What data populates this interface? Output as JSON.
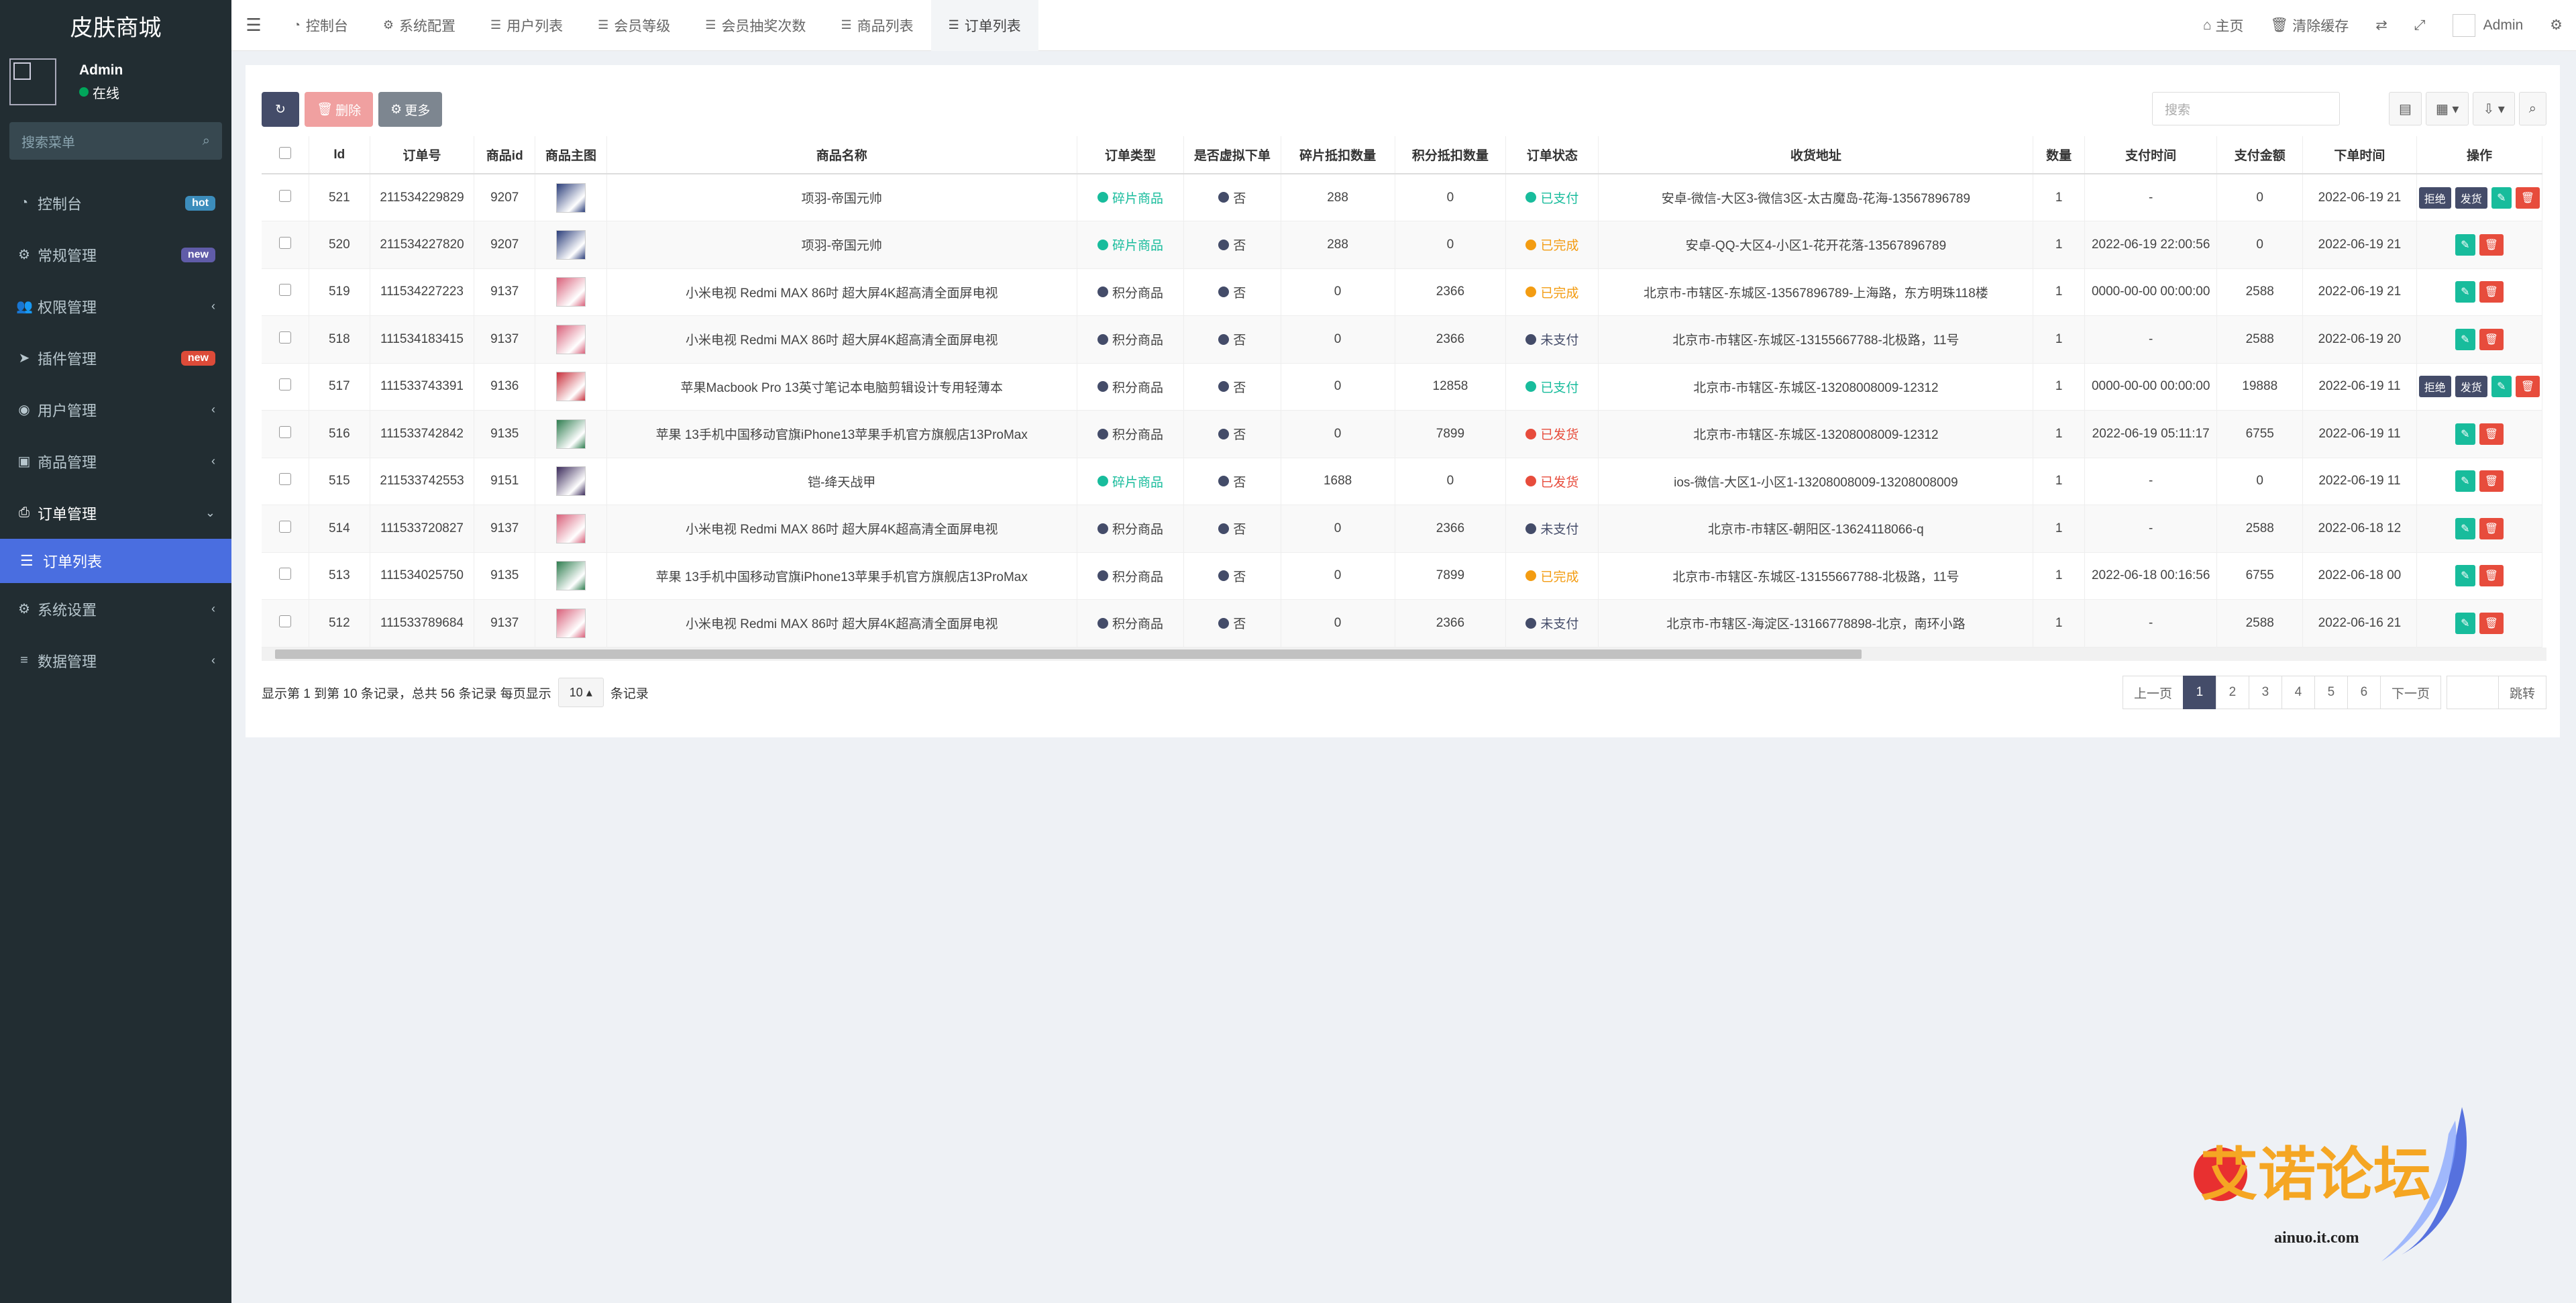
{
  "app": {
    "title": "皮肤商城"
  },
  "user": {
    "name": "Admin",
    "status": "在线",
    "status_color": "#00a65a"
  },
  "sidebar": {
    "search_placeholder": "搜索菜单",
    "items": [
      {
        "label": "控制台",
        "icon": "dashboard-icon",
        "badge": "hot",
        "badge_color": "#3c8dbc"
      },
      {
        "label": "常规管理",
        "icon": "cogs-icon",
        "badge": "new",
        "badge_color": "#605ca8"
      },
      {
        "label": "权限管理",
        "icon": "group-icon",
        "chevron": "‹"
      },
      {
        "label": "插件管理",
        "icon": "rocket-icon",
        "badge": "new",
        "badge_color": "#dd4b39"
      },
      {
        "label": "用户管理",
        "icon": "user-circle-icon",
        "chevron": "‹"
      },
      {
        "label": "商品管理",
        "icon": "gift-icon",
        "chevron": "‹"
      },
      {
        "label": "订单管理",
        "icon": "print-icon",
        "chevron": "⌄"
      },
      {
        "label": "系统设置",
        "icon": "gear-icon",
        "chevron": "‹"
      },
      {
        "label": "数据管理",
        "icon": "database-icon",
        "chevron": "‹"
      }
    ],
    "sub_active": "订单列表"
  },
  "topbar": {
    "tabs": [
      "控制台",
      "系统配置",
      "用户列表",
      "会员等级",
      "会员抽奖次数",
      "商品列表",
      "订单列表"
    ],
    "right": {
      "home": "主页",
      "clear_cache": "清除缓存",
      "admin": "Admin"
    }
  },
  "toolbar": {
    "delete_label": "删除",
    "more_label": "更多",
    "search_placeholder": "搜索"
  },
  "table": {
    "headers": [
      "Id",
      "订单号",
      "商品id",
      "商品主图",
      "商品名称",
      "订单类型",
      "是否虚拟下单",
      "碎片抵扣数量",
      "积分抵扣数量",
      "订单状态",
      "收货地址",
      "数量",
      "支付时间",
      "支付金额",
      "下单时间",
      "操作"
    ],
    "rows": [
      {
        "id": "521",
        "order_no": "211534229829",
        "goods_id": "9207",
        "name": "项羽-帝国元帅",
        "type": "碎片商品",
        "virtual": "否",
        "frag": "288",
        "points": "0",
        "status": "已支付",
        "address": "安卓-微信-大区3-微信3区-太古魔岛-花海-13567896789",
        "qty": "1",
        "pay_time": "-",
        "amount": "0",
        "created": "2022-06-19 21",
        "actions": [
          "拒绝",
          "发货",
          "edit",
          "delete"
        ],
        "img_color": "#2a3d7a"
      },
      {
        "id": "520",
        "order_no": "211534227820",
        "goods_id": "9207",
        "name": "项羽-帝国元帅",
        "type": "碎片商品",
        "virtual": "否",
        "frag": "288",
        "points": "0",
        "status": "已完成",
        "address": "安卓-QQ-大区4-小区1-花开花落-13567896789",
        "qty": "1",
        "pay_time": "2022-06-19 22:00:56",
        "amount": "0",
        "created": "2022-06-19 21",
        "actions": [
          "edit",
          "delete"
        ],
        "img_color": "#2a3d7a"
      },
      {
        "id": "519",
        "order_no": "111534227223",
        "goods_id": "9137",
        "name": "小米电视 Redmi MAX 86吋 超大屏4K超高清全面屏电视",
        "type": "积分商品",
        "virtual": "否",
        "frag": "0",
        "points": "2366",
        "status": "已完成",
        "address": "北京市-市辖区-东城区-13567896789-上海路，东方明珠118楼",
        "qty": "1",
        "pay_time": "0000-00-00 00:00:00",
        "amount": "2588",
        "created": "2022-06-19 21",
        "actions": [
          "edit",
          "delete"
        ],
        "img_color": "#d9607a"
      },
      {
        "id": "518",
        "order_no": "111534183415",
        "goods_id": "9137",
        "name": "小米电视 Redmi MAX 86吋 超大屏4K超高清全面屏电视",
        "type": "积分商品",
        "virtual": "否",
        "frag": "0",
        "points": "2366",
        "status": "未支付",
        "address": "北京市-市辖区-东城区-13155667788-北极路，11号",
        "qty": "1",
        "pay_time": "-",
        "amount": "2588",
        "created": "2022-06-19 20",
        "actions": [
          "edit",
          "delete"
        ],
        "img_color": "#d9607a"
      },
      {
        "id": "517",
        "order_no": "111533743391",
        "goods_id": "9136",
        "name": "苹果Macbook Pro 13英寸笔记本电脑剪辑设计专用轻薄本",
        "type": "积分商品",
        "virtual": "否",
        "frag": "0",
        "points": "12858",
        "status": "已支付",
        "address": "北京市-市辖区-东城区-13208008009-12312",
        "qty": "1",
        "pay_time": "0000-00-00 00:00:00",
        "amount": "19888",
        "created": "2022-06-19 11",
        "actions": [
          "拒绝",
          "发货",
          "edit",
          "delete"
        ],
        "img_color": "#c9303c"
      },
      {
        "id": "516",
        "order_no": "111533742842",
        "goods_id": "9135",
        "name": "苹果 13手机中国移动官旗iPhone13苹果手机官方旗舰店13ProMax",
        "type": "积分商品",
        "virtual": "否",
        "frag": "0",
        "points": "7899",
        "status": "已发货",
        "address": "北京市-市辖区-东城区-13208008009-12312",
        "qty": "1",
        "pay_time": "2022-06-19 05:11:17",
        "amount": "6755",
        "created": "2022-06-19 11",
        "actions": [
          "edit",
          "delete"
        ],
        "img_color": "#2e7d4f"
      },
      {
        "id": "515",
        "order_no": "211533742553",
        "goods_id": "9151",
        "name": "铠-绛天战甲",
        "type": "碎片商品",
        "virtual": "否",
        "frag": "1688",
        "points": "0",
        "status": "已发货",
        "address": "ios-微信-大区1-小区1-13208008009-13208008009",
        "qty": "1",
        "pay_time": "-",
        "amount": "0",
        "created": "2022-06-19 11",
        "actions": [
          "edit",
          "delete"
        ],
        "img_color": "#3a2a5a"
      },
      {
        "id": "514",
        "order_no": "111533720827",
        "goods_id": "9137",
        "name": "小米电视 Redmi MAX 86吋 超大屏4K超高清全面屏电视",
        "type": "积分商品",
        "virtual": "否",
        "frag": "0",
        "points": "2366",
        "status": "未支付",
        "address": "北京市-市辖区-朝阳区-13624118066-q",
        "qty": "1",
        "pay_time": "-",
        "amount": "2588",
        "created": "2022-06-18 12",
        "actions": [
          "edit",
          "delete"
        ],
        "img_color": "#d9607a"
      },
      {
        "id": "513",
        "order_no": "111534025750",
        "goods_id": "9135",
        "name": "苹果 13手机中国移动官旗iPhone13苹果手机官方旗舰店13ProMax",
        "type": "积分商品",
        "virtual": "否",
        "frag": "0",
        "points": "7899",
        "status": "已完成",
        "address": "北京市-市辖区-东城区-13155667788-北极路，11号",
        "qty": "1",
        "pay_time": "2022-06-18 00:16:56",
        "amount": "6755",
        "created": "2022-06-18 00",
        "actions": [
          "edit",
          "delete"
        ],
        "img_color": "#2e7d4f"
      },
      {
        "id": "512",
        "order_no": "111533789684",
        "goods_id": "9137",
        "name": "小米电视 Redmi MAX 86吋 超大屏4K超高清全面屏电视",
        "type": "积分商品",
        "virtual": "否",
        "frag": "0",
        "points": "2366",
        "status": "未支付",
        "address": "北京市-市辖区-海淀区-13166778898-北京，南环小路",
        "qty": "1",
        "pay_time": "-",
        "amount": "2588",
        "created": "2022-06-16 21",
        "actions": [
          "edit",
          "delete"
        ],
        "img_color": "#d9607a"
      }
    ]
  },
  "colors": {
    "碎片商品": "#18bc9c",
    "积分商品": "#444c69",
    "已支付": "#18bc9c",
    "已完成": "#f39c12",
    "未支付": "#444c69",
    "已发货": "#e74c3c",
    "否": "#444c69"
  },
  "pager": {
    "info_prefix": "显示第 1 到第 10 条记录，总共 56 条记录 每页显示",
    "page_size": "10",
    "info_suffix": "条记录",
    "prev": "上一页",
    "pages": [
      "1",
      "2",
      "3",
      "4",
      "5",
      "6"
    ],
    "next": "下一页",
    "jump": "跳转",
    "current": "1"
  },
  "watermark": {
    "text": "艾诺论坛",
    "url": "ainuo.it.com"
  }
}
